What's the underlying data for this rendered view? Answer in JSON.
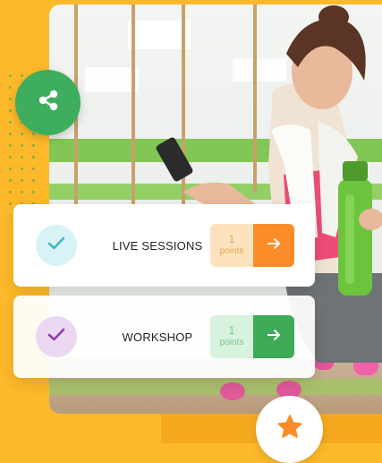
{
  "colors": {
    "background": "#FDB92A",
    "share_button": "#3FAD5E",
    "orange_accent": "#FB8C2A",
    "green_accent": "#3FAA57",
    "star": "#FB8C2A"
  },
  "share": {
    "icon": "share-icon"
  },
  "cards": [
    {
      "title": "LIVE SESSIONS",
      "points_value": "1",
      "points_label": "points",
      "check_icon": "check-icon",
      "arrow_icon": "arrow-right-icon"
    },
    {
      "title": "WORKSHOP",
      "points_value": "1",
      "points_label": "points",
      "check_icon": "check-icon",
      "arrow_icon": "arrow-right-icon"
    }
  ],
  "favorite": {
    "icon": "star-icon"
  }
}
